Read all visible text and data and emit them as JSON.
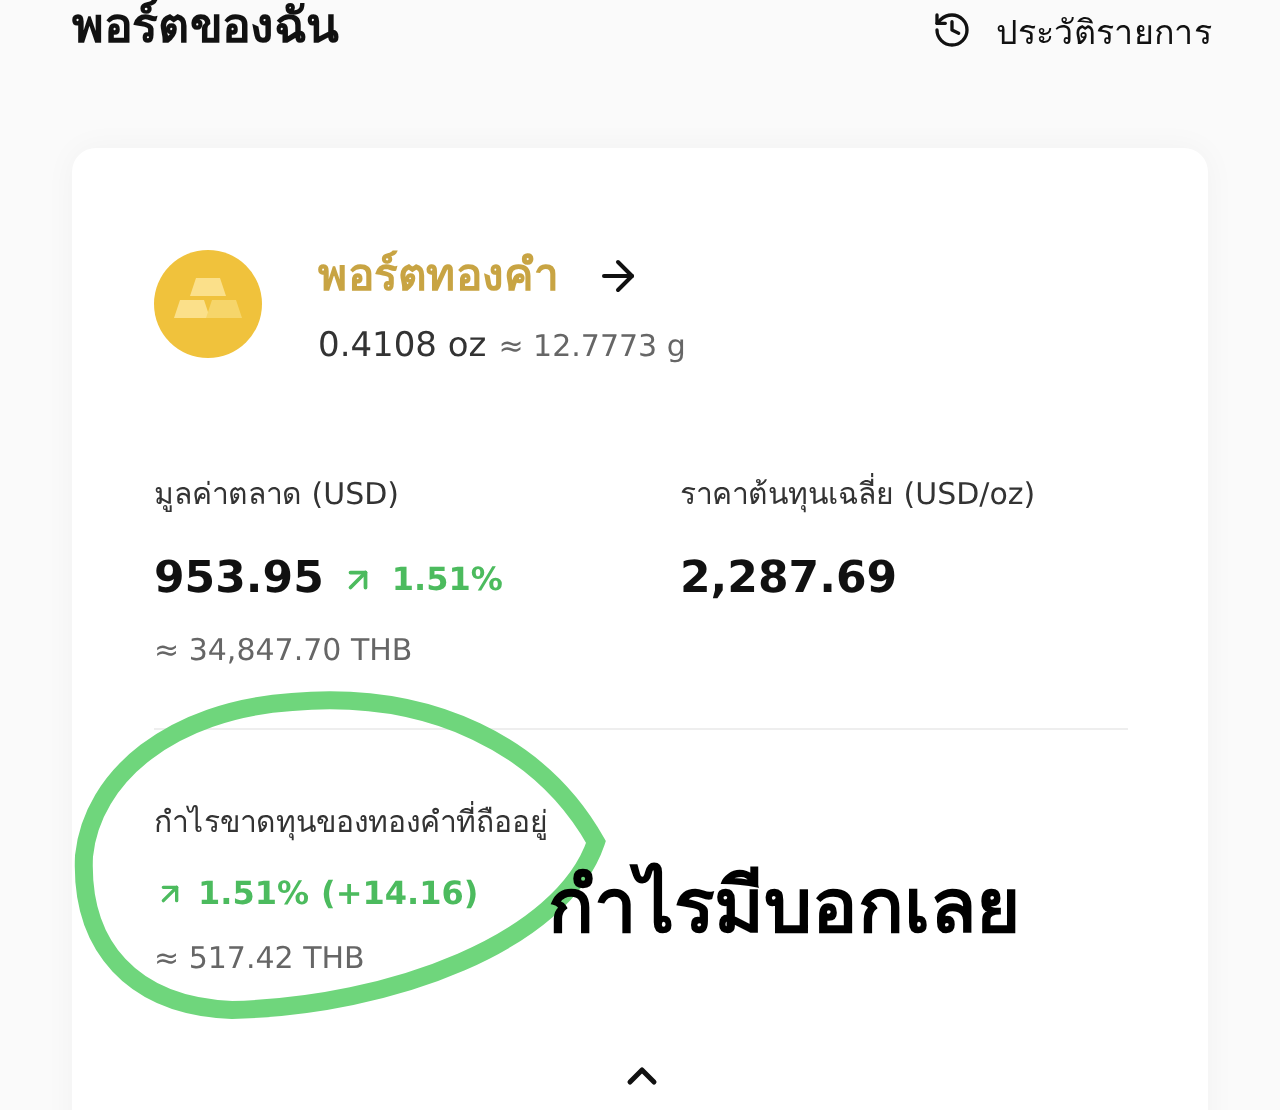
{
  "header": {
    "title": "พอร์ตของฉัน",
    "history_link": "ประวัติรายการ"
  },
  "portfolio": {
    "name": "พอร์ตทองคำ",
    "amount": "0.4108 oz",
    "approx": "≈ 12.7773 g"
  },
  "stats": [
    {
      "label": "มูลค่าตลาด (USD)",
      "value": "953.95",
      "change": "1.51%",
      "sub": "≈ 34,847.70 THB"
    },
    {
      "label": "ราคาต้นทุนเฉลี่ย (USD/oz)",
      "value": "2,287.69"
    }
  ],
  "profit": {
    "label": "กำไรขาดทุนของทองคำที่ถืออยู่",
    "change": "1.51%",
    "amount": "(+14.16)",
    "sub": "≈ 517.42 THB"
  },
  "annotation": {
    "text": "กำไรมีบอกเลย"
  }
}
